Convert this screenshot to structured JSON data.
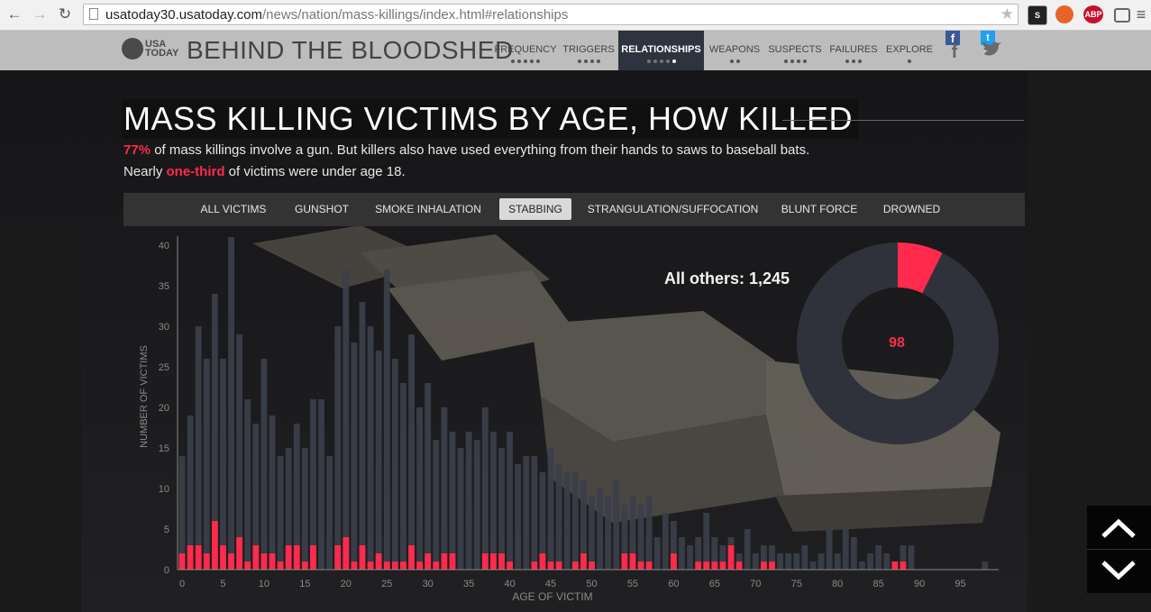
{
  "browser": {
    "url_host": "usatoday30.usatoday.com",
    "url_path": "/news/nation/mass-killings/index.html#relationships",
    "extensions": [
      "S",
      "",
      "ABP",
      ""
    ]
  },
  "site": {
    "logo_line1": "USA",
    "logo_line2": "TODAY",
    "title": "BEHIND THE BLOODSHED",
    "nav": [
      {
        "label": "FREQUENCY",
        "dots": 5,
        "active": false
      },
      {
        "label": "TRIGGERS",
        "dots": 4,
        "active": false
      },
      {
        "label": "RELATIONSHIPS",
        "dots": 5,
        "active": true
      },
      {
        "label": "WEAPONS",
        "dots": 2,
        "active": false
      },
      {
        "label": "SUSPECTS",
        "dots": 4,
        "active": false
      },
      {
        "label": "FAILURES",
        "dots": 3,
        "active": false
      },
      {
        "label": "EXPLORE",
        "dots": 1,
        "active": false
      }
    ],
    "social": {
      "facebook": "f",
      "twitter": "t"
    }
  },
  "article": {
    "headline": "MASS KILLING VICTIMS BY AGE, HOW KILLED",
    "line1_highlight": "77%",
    "line1_rest": " of mass killings involve a gun. But killers also have used everything from their hands to saws to baseball bats.",
    "line2_pre": "Nearly ",
    "line2_highlight": "one-third",
    "line2_post": " of victims were under age 18."
  },
  "filters": [
    {
      "label": "ALL VICTIMS",
      "active": false
    },
    {
      "label": "GUNSHOT",
      "active": false
    },
    {
      "label": "SMOKE INHALATION",
      "active": false
    },
    {
      "label": "STABBING",
      "active": true
    },
    {
      "label": "STRANGULATION/SUFFOCATION",
      "active": false
    },
    {
      "label": "BLUNT FORCE",
      "active": false
    },
    {
      "label": "DROWNED",
      "active": false
    }
  ],
  "donut": {
    "others_label": "All others: 1,245",
    "selected_value": "98",
    "selected": 98,
    "others": 1245
  },
  "colors": {
    "accent": "#ff2a4c",
    "total_bar": "#3b3f4a",
    "donut_rest": "#2f323a",
    "nav_active": "#2e3340"
  },
  "chart_data": {
    "type": "bar",
    "xlabel": "AGE OF VICTIM",
    "ylabel": "NUMBER OF VICTIMS",
    "xlim": [
      0,
      100
    ],
    "ylim": [
      0,
      40
    ],
    "x_ticks": [
      0,
      5,
      10,
      15,
      20,
      25,
      30,
      35,
      40,
      45,
      50,
      55,
      60,
      65,
      70,
      75,
      80,
      85,
      90,
      95
    ],
    "y_ticks": [
      0,
      5,
      10,
      15,
      20,
      25,
      30,
      35,
      40
    ],
    "series": [
      {
        "name": "ALL VICTIMS",
        "color": "#3b3f4a",
        "values": [
          14,
          19,
          30,
          26,
          34,
          26,
          41,
          29,
          21,
          18,
          26,
          19,
          14,
          15,
          18,
          15,
          21,
          21,
          14,
          30,
          37,
          28,
          33,
          30,
          27,
          37,
          26,
          23,
          29,
          20,
          23,
          16,
          20,
          17,
          15,
          17,
          16,
          20,
          17,
          15,
          17,
          13,
          14,
          14,
          12,
          15,
          13,
          12,
          12,
          11,
          9,
          10,
          9,
          11,
          8,
          9,
          8,
          9,
          4,
          7,
          6,
          4,
          3,
          4,
          7,
          4,
          3,
          4,
          2,
          5,
          2,
          3,
          3,
          2,
          2,
          2,
          3,
          1,
          2,
          5,
          2,
          5,
          4,
          1,
          2,
          3,
          2,
          1,
          3,
          3,
          0,
          0,
          0,
          0,
          0,
          0,
          0,
          0,
          1,
          0,
          0
        ]
      },
      {
        "name": "STABBING",
        "color": "#ff2a4c",
        "values": [
          2,
          3,
          3,
          2,
          6,
          3,
          2,
          4,
          1,
          3,
          2,
          2,
          1,
          3,
          3,
          1,
          3,
          0,
          0,
          3,
          4,
          1,
          3,
          1,
          2,
          1,
          1,
          1,
          3,
          1,
          2,
          1,
          2,
          2,
          0,
          0,
          0,
          2,
          2,
          2,
          1,
          0,
          0,
          1,
          2,
          1,
          1,
          0,
          1,
          2,
          1,
          0,
          0,
          0,
          2,
          2,
          1,
          1,
          0,
          0,
          2,
          0,
          0,
          1,
          1,
          1,
          1,
          3,
          1,
          0,
          0,
          1,
          1,
          0,
          0,
          0,
          0,
          0,
          0,
          0,
          0,
          0,
          0,
          0,
          0,
          0,
          0,
          1,
          1,
          0,
          0,
          0,
          0,
          0,
          0,
          0,
          0,
          0,
          0,
          0,
          0
        ]
      }
    ]
  }
}
